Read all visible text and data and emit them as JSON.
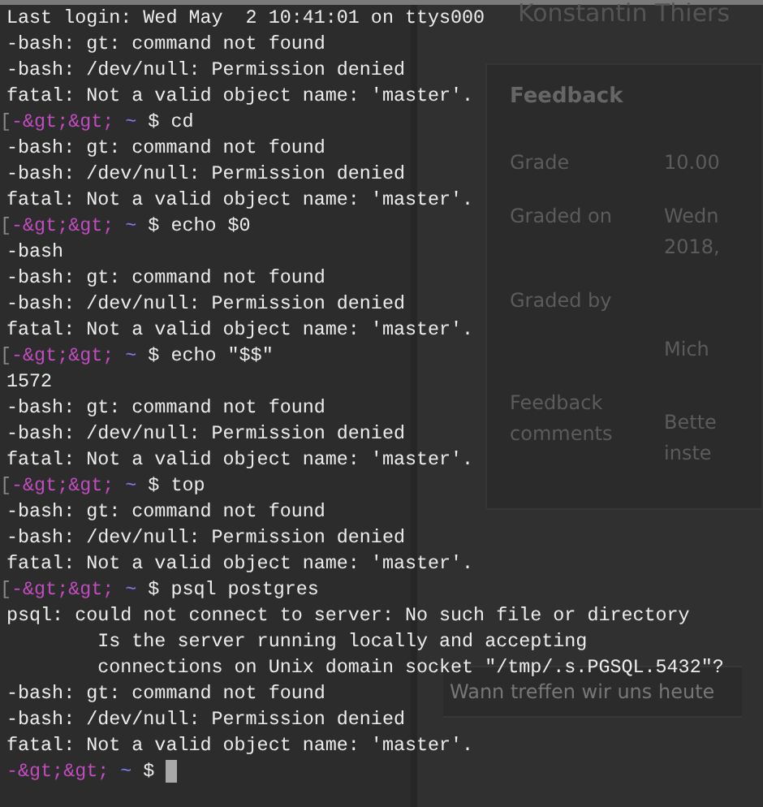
{
  "background_page": {
    "contact_name": "Konstantin Thiers",
    "feedback": {
      "title": "Feedback",
      "rows": [
        {
          "label": "Grade",
          "values": [
            "10.00"
          ]
        },
        {
          "label": "Graded on",
          "values": [
            "Wedn",
            "2018,"
          ]
        },
        {
          "label": "Graded by",
          "values": [
            "Mich"
          ]
        },
        {
          "label": "Feedback comments",
          "values": [
            "Bette",
            "inste"
          ]
        }
      ]
    },
    "message_input": {
      "value": "Wann treffen wir uns heute"
    }
  },
  "terminal": {
    "lines": [
      {
        "kind": "output",
        "text": "Last login: Wed May  2 10:41:01 on ttys000"
      },
      {
        "kind": "output",
        "text": "-bash: gt: command not found"
      },
      {
        "kind": "output",
        "text": "-bash: /dev/null: Permission denied"
      },
      {
        "kind": "output",
        "text": "fatal: Not a valid object name: 'master'."
      },
      {
        "kind": "prompt",
        "marker": "[",
        "user": "-&gt;&gt;",
        "dir": "~",
        "command": "$ cd"
      },
      {
        "kind": "output",
        "text": "-bash: gt: command not found"
      },
      {
        "kind": "output",
        "text": "-bash: /dev/null: Permission denied"
      },
      {
        "kind": "output",
        "text": "fatal: Not a valid object name: 'master'."
      },
      {
        "kind": "prompt",
        "marker": "[",
        "user": "-&gt;&gt;",
        "dir": "~",
        "command": "$ echo $0"
      },
      {
        "kind": "output",
        "text": "-bash"
      },
      {
        "kind": "output",
        "text": "-bash: gt: command not found"
      },
      {
        "kind": "output",
        "text": "-bash: /dev/null: Permission denied"
      },
      {
        "kind": "output",
        "text": "fatal: Not a valid object name: 'master'."
      },
      {
        "kind": "prompt",
        "marker": "[",
        "user": "-&gt;&gt;",
        "dir": "~",
        "command": "$ echo \"$$\""
      },
      {
        "kind": "output",
        "text": "1572"
      },
      {
        "kind": "output",
        "text": "-bash: gt: command not found"
      },
      {
        "kind": "output",
        "text": "-bash: /dev/null: Permission denied"
      },
      {
        "kind": "output",
        "text": "fatal: Not a valid object name: 'master'."
      },
      {
        "kind": "prompt",
        "marker": "[",
        "user": "-&gt;&gt;",
        "dir": "~",
        "command": "$ top"
      },
      {
        "kind": "output",
        "text": "-bash: gt: command not found"
      },
      {
        "kind": "output",
        "text": "-bash: /dev/null: Permission denied"
      },
      {
        "kind": "output",
        "text": "fatal: Not a valid object name: 'master'."
      },
      {
        "kind": "prompt",
        "marker": "[",
        "user": "-&gt;&gt;",
        "dir": "~",
        "command": "$ psql postgres"
      },
      {
        "kind": "output",
        "text": "psql: could not connect to server: No such file or directory"
      },
      {
        "kind": "output",
        "text": "        Is the server running locally and accepting"
      },
      {
        "kind": "output",
        "text": "        connections on Unix domain socket \"/tmp/.s.PGSQL.5432\"?"
      },
      {
        "kind": "output",
        "text": "-bash: gt: command not found"
      },
      {
        "kind": "output",
        "text": "-bash: /dev/null: Permission denied"
      },
      {
        "kind": "output",
        "text": "fatal: Not a valid object name: 'master'."
      },
      {
        "kind": "prompt",
        "user": "-&gt;&gt;",
        "dir": "~",
        "command": "$",
        "cursor": true
      }
    ]
  }
}
